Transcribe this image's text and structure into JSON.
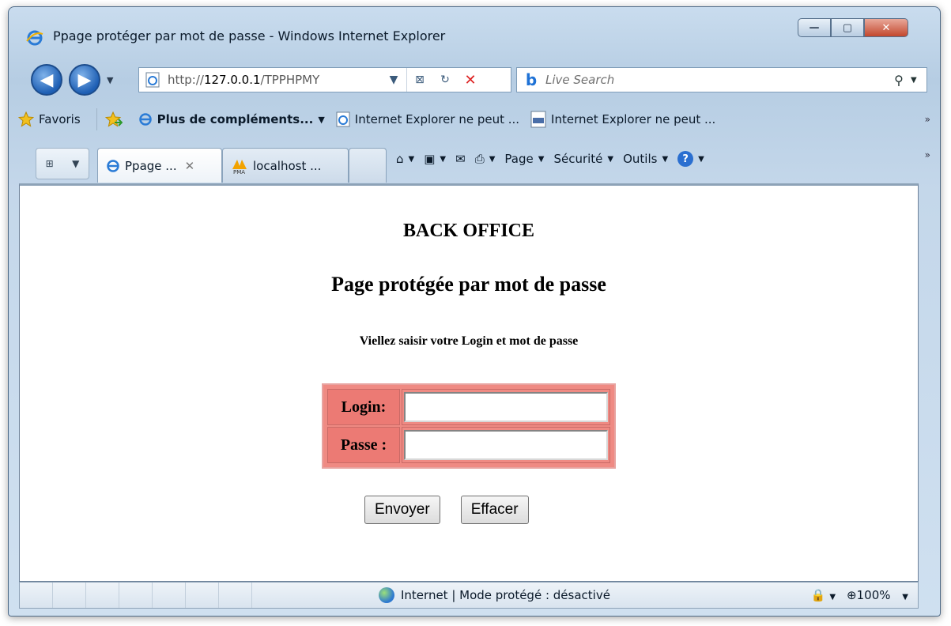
{
  "window": {
    "title": "Ppage protéger par mot de passe - Windows Internet Explorer"
  },
  "address": {
    "url_prefix": "http://",
    "url_host": "127.0.0.1",
    "url_rest": "/TPPHPMY"
  },
  "search": {
    "placeholder": "Live Search"
  },
  "favorites": {
    "favoris": "Favoris",
    "more": "Plus de compléments...",
    "link1": "Internet Explorer ne peut ...",
    "link2": "Internet Explorer ne peut ..."
  },
  "tabs": [
    {
      "label": "Ppage ..."
    },
    {
      "label": "localhost ..."
    }
  ],
  "commands": {
    "page": "Page",
    "security": "Sécurité",
    "tools": "Outils"
  },
  "page": {
    "heading1": "BACK OFFICE",
    "heading2": "Page protégée par mot de passe",
    "instruction": "Viellez saisir votre Login et mot de passe",
    "login_label": "Login:",
    "password_label": "Passe :",
    "login_value": "",
    "password_value": "",
    "submit": "Envoyer",
    "reset": "Effacer"
  },
  "status": {
    "zone": "Internet | Mode protégé : désactivé",
    "zoom": "100%"
  },
  "colors": {
    "form_bg": "#ef8a83",
    "window_frame": "#c9dcee"
  }
}
